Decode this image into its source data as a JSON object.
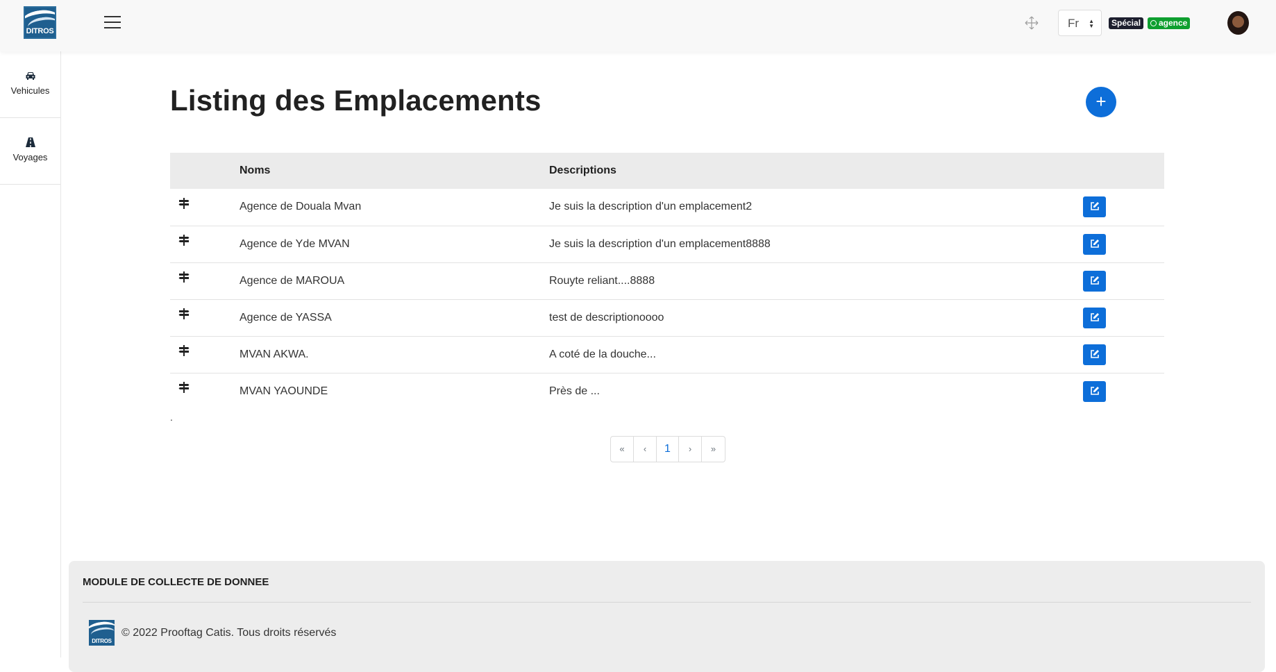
{
  "header": {
    "logo_text": "DITROS",
    "language": "Fr",
    "badge_special": "Spécial",
    "badge_agence": "agence"
  },
  "sidebar": {
    "items": [
      {
        "label": "Vehicules",
        "icon": "car-icon"
      },
      {
        "label": "Voyages",
        "icon": "road-icon"
      }
    ]
  },
  "main": {
    "title": "Listing des Emplacements",
    "add_button": "+",
    "table": {
      "columns": [
        "",
        "Noms",
        "Descriptions",
        ""
      ],
      "rows": [
        {
          "nom": "Agence de Douala Mvan",
          "description": "Je suis la description d'un emplacement2"
        },
        {
          "nom": "Agence de Yde MVAN",
          "description": "Je suis la description d'un emplacement8888"
        },
        {
          "nom": "Agence de MAROUA",
          "description": "Rouyte reliant....8888"
        },
        {
          "nom": "Agence de YASSA",
          "description": "test de descriptionoooo"
        },
        {
          "nom": "MVAN AKWA.",
          "description": "A coté de la douche..."
        },
        {
          "nom": "MVAN YAOUNDE",
          "description": "Près de ..."
        }
      ]
    },
    "trailing_text": ".",
    "pagination": {
      "first": "«",
      "prev": "‹",
      "current": "1",
      "next": "›",
      "last": "»"
    }
  },
  "footer": {
    "title": "MODULE DE COLLECTE DE DONNEE",
    "logo_text": "DITROS",
    "copyright": "© 2022 Prooftag Catis. Tous droits réservés"
  },
  "colors": {
    "primary": "#0d6ed9",
    "badge_dark": "#1d1f2e",
    "badge_green": "#0e9f2f",
    "header_bg": "#f8f8f8",
    "table_head_bg": "#ebebeb",
    "footer_bg": "#ededed"
  }
}
